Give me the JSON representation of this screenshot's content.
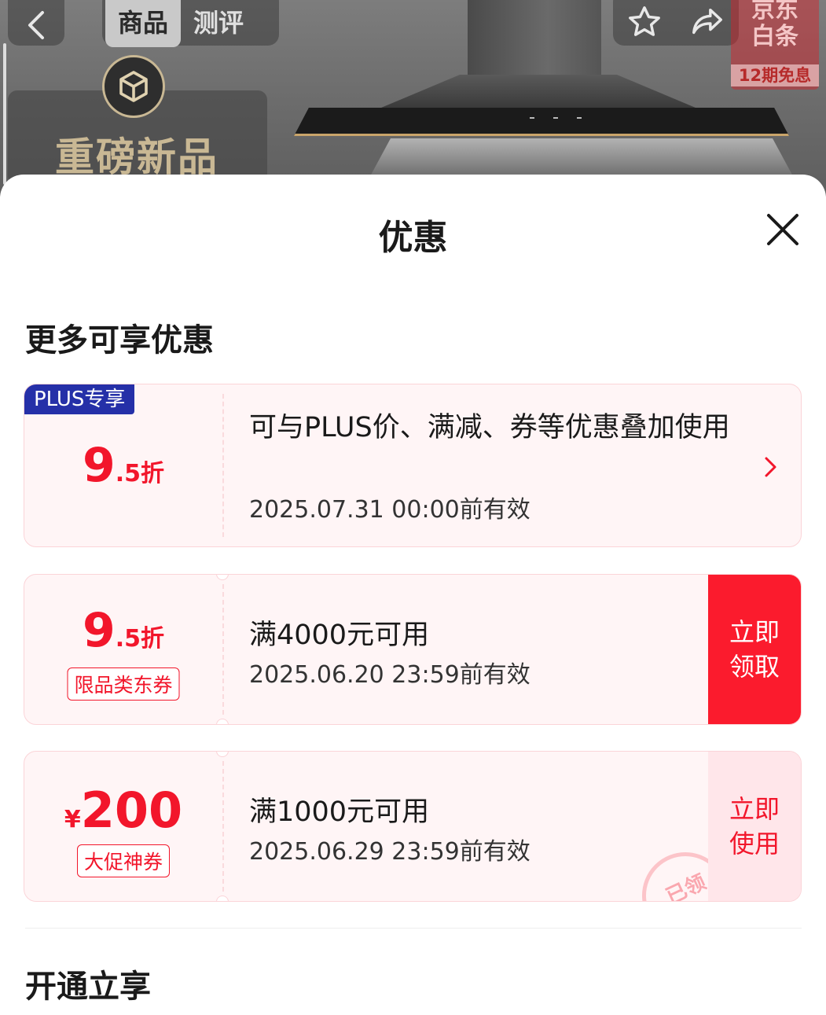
{
  "header": {
    "tabs": [
      {
        "label": "商品",
        "active": true
      },
      {
        "label": "测评",
        "active": false
      }
    ],
    "baitiao": {
      "title": "京东白条",
      "subtitle": "12期免息"
    },
    "promo_label": "重磅新品"
  },
  "sheet": {
    "title": "优惠",
    "section_more": "更多可享优惠",
    "section_open": "开通立享"
  },
  "coupons": [
    {
      "tag": "PLUS专享",
      "amount_big": "9",
      "amount_small": ".5折",
      "description": "可与PLUS价、满减、券等优惠叠加使用",
      "valid": "2025.07.31 00:00前有效"
    },
    {
      "amount_big": "9",
      "amount_small": ".5折",
      "type_label": "限品类东券",
      "description": "满4000元可用",
      "valid": "2025.06.20 23:59前有效",
      "action": "立即领取"
    },
    {
      "currency": "¥",
      "amount_big": "200",
      "type_label": "大促神券",
      "description": "满1000元可用",
      "valid": "2025.06.29 23:59前有效",
      "action": "立即使用",
      "stamp": "已领"
    }
  ],
  "colors": {
    "accent_red": "#f2162b",
    "plus_blue": "#2530a8",
    "coupon_bg": "#fff5f6"
  }
}
